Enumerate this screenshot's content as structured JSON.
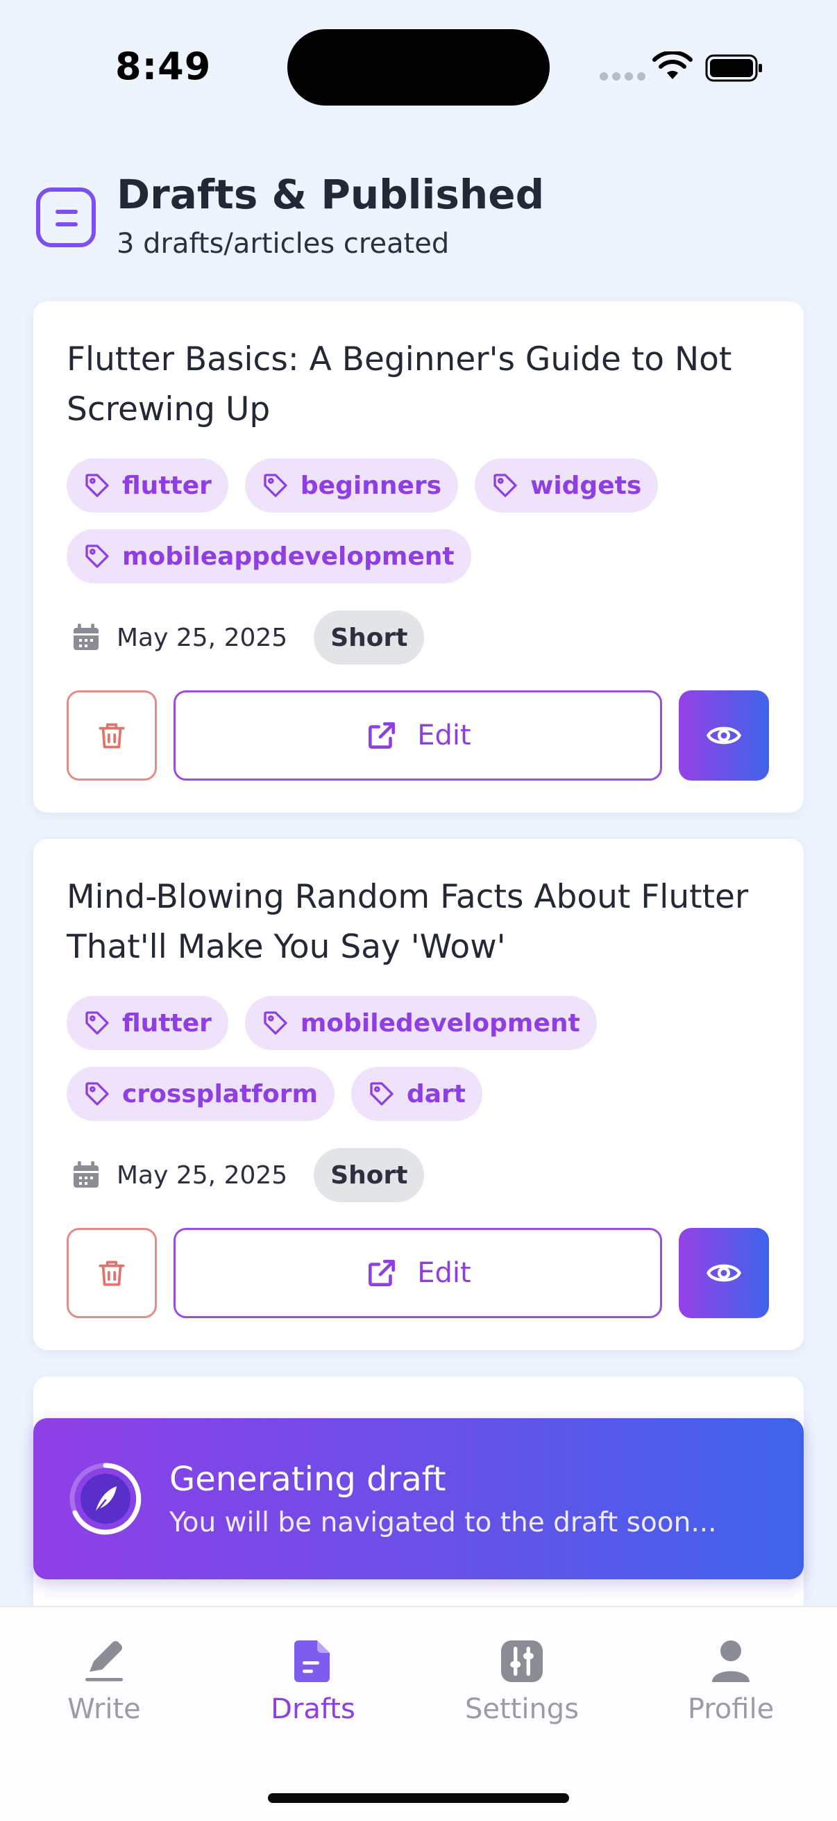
{
  "status_bar": {
    "time": "8:49"
  },
  "header": {
    "title": "Drafts & Published",
    "subtitle": "3 drafts/articles created",
    "icon": "notes-icon"
  },
  "colors": {
    "accent": "#8e3ee3",
    "tag_bg": "#efe3fc",
    "delete": "#e48b85",
    "gradient_start": "#9542e5",
    "gradient_end": "#3f63ea",
    "background": "#eef4fe"
  },
  "articles": [
    {
      "title": "Flutter Basics: A Beginner's Guide to Not Screwing Up",
      "tags": [
        "flutter",
        "beginners",
        "widgets",
        "mobileappdevelopment"
      ],
      "date": "May 25, 2025",
      "length": "Short",
      "edit_label": "Edit"
    },
    {
      "title": "Mind-Blowing Random Facts About Flutter That'll Make You Say 'Wow'",
      "tags": [
        "flutter",
        "mobiledevelopment",
        "crossplatform",
        "dart"
      ],
      "date": "May 25, 2025",
      "length": "Short",
      "edit_label": "Edit"
    }
  ],
  "toast": {
    "title": "Generating draft",
    "message": "You will be navigated to the draft soon...",
    "icon": "feather-icon"
  },
  "bottom_nav": {
    "items": [
      {
        "label": "Write",
        "icon": "pen-icon",
        "active": false
      },
      {
        "label": "Drafts",
        "icon": "document-icon",
        "active": true
      },
      {
        "label": "Settings",
        "icon": "sliders-icon",
        "active": false
      },
      {
        "label": "Profile",
        "icon": "user-icon",
        "active": false
      }
    ]
  }
}
